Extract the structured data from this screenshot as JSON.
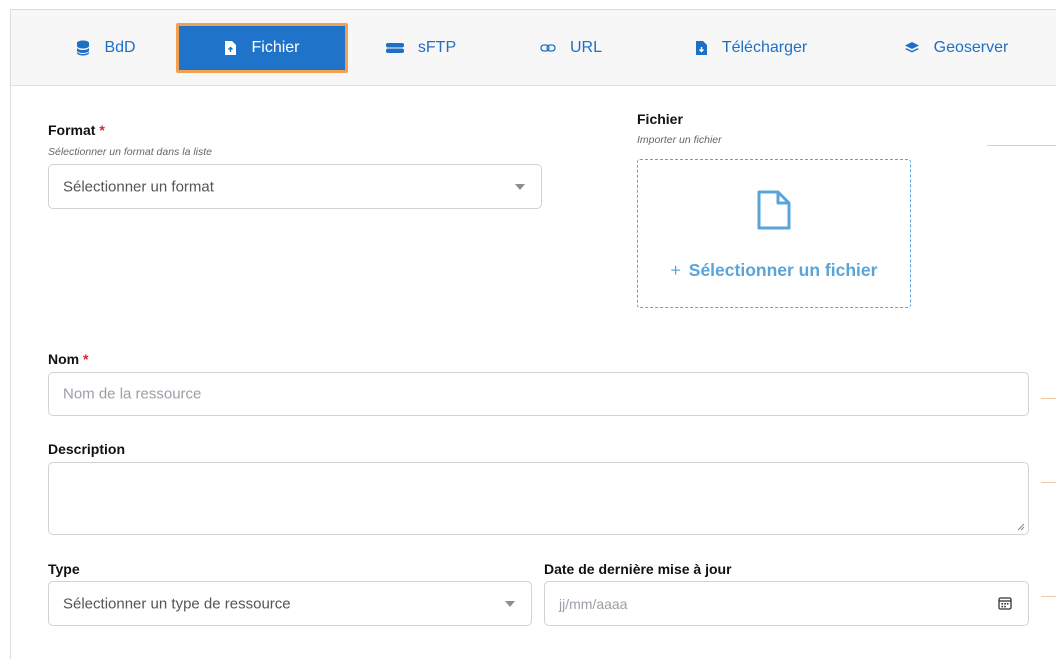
{
  "tabs": [
    {
      "label": "BdD",
      "icon": "database-icon"
    },
    {
      "label": "Fichier",
      "icon": "file-upload-icon",
      "active": true
    },
    {
      "label": "sFTP",
      "icon": "server-icon"
    },
    {
      "label": "URL",
      "icon": "link-icon"
    },
    {
      "label": "Télécharger",
      "icon": "file-download-icon"
    },
    {
      "label": "Geoserver",
      "icon": "layers-icon"
    }
  ],
  "format": {
    "label": "Format",
    "required_mark": "*",
    "hint": "Sélectionner un format dans la liste",
    "placeholder": "Sélectionner un format"
  },
  "file": {
    "label": "Fichier",
    "hint": "Importer un fichier",
    "plus": "+",
    "action": "Sélectionner un fichier"
  },
  "name": {
    "label": "Nom",
    "required_mark": "*",
    "placeholder": "Nom de la ressource"
  },
  "description": {
    "label": "Description",
    "value": ""
  },
  "type": {
    "label": "Type",
    "placeholder": "Sélectionner un type de ressource"
  },
  "date": {
    "label": "Date de dernière mise à jour",
    "placeholder": "jj/mm/aaaa"
  },
  "colors": {
    "primary": "#1f73c8",
    "link_blue": "#1f6fc5",
    "highlight_orange": "#f0a050",
    "dropzone_blue": "#5aa4d9",
    "required_red": "#d62728"
  }
}
